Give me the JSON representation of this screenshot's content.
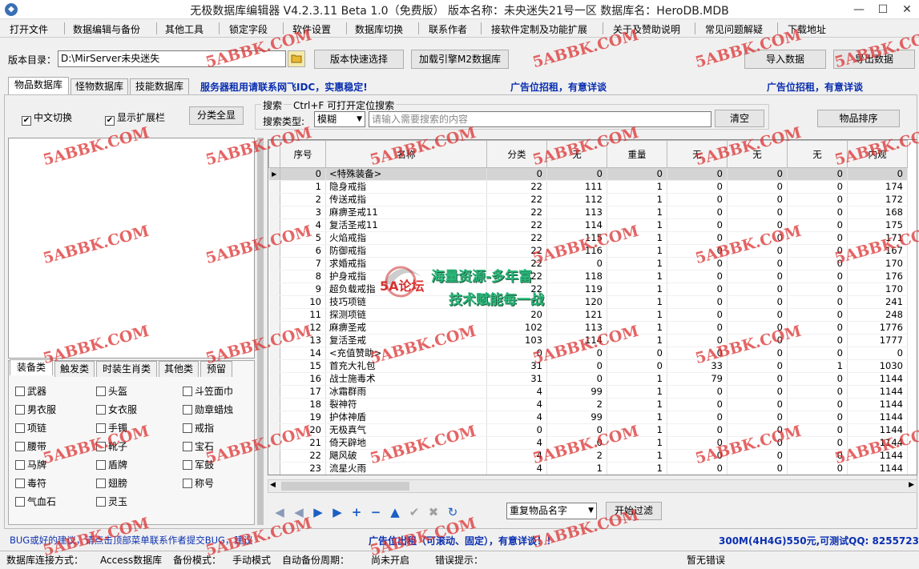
{
  "window": {
    "title": "无极数据库编辑器 V4.2.3.11    Beta 1.0（免费版）    版本名称：未央迷失21号一区    数据库名：HeroDB.MDB",
    "minimize": "—",
    "maximize": "☐",
    "close": "✕"
  },
  "menu": [
    "打开文件",
    "数据编辑与备份",
    "其他工具",
    "锁定字段",
    "软件设置",
    "数据库切换",
    "联系作者",
    "接软件定制及功能扩展",
    "关于及赞助说明",
    "常见问题解疑",
    "下载地址"
  ],
  "toolbar": {
    "dir_label": "版本目录：",
    "dir_value": "D:\\MirServer未央迷失",
    "folder_icon": "folder-icon",
    "quick_select": "版本快速选择",
    "load_engine": "加载引擎M2数据库",
    "import": "导入数据",
    "export": "导出数据"
  },
  "tabs": [
    "物品数据库",
    "怪物数据库",
    "技能数据库"
  ],
  "ads": {
    "ad1": "服务器租用请联系网飞IDC，实惠稳定!",
    "ad2": "广告位招租，有意详谈",
    "ad3": "广告位招租，有意详谈",
    "bottom": "广告位出租（可滚动、固定），有意详谈！！"
  },
  "options": {
    "chinese_switch": "中文切换",
    "show_expand": "显示扩展栏",
    "expand_all": "分类全显"
  },
  "search": {
    "title": "搜索",
    "hint": "Ctrl+F 可打开定位搜索",
    "type_label": "搜索类型:",
    "type_value": "模糊",
    "placeholder": "请输入需要搜索的内容",
    "clear": "清空",
    "sort": "物品排序"
  },
  "category_tabs": [
    "装备类",
    "触发类",
    "时装生肖类",
    "其他类",
    "预留"
  ],
  "categories": [
    "武器",
    "头盔",
    "斗笠面巾",
    "男衣服",
    "女衣服",
    "勋章蜡烛",
    "项链",
    "手镯",
    "戒指",
    "腰带",
    "靴子",
    "宝石",
    "马牌",
    "盾牌",
    "军鼓",
    "毒符",
    "翅膀",
    "称号",
    "气血石",
    "灵玉"
  ],
  "grid": {
    "columns": [
      "序号",
      "名称",
      "分类",
      "无",
      "重量",
      "无",
      "无",
      "无",
      "内观"
    ],
    "rows": [
      [
        "0",
        "<特殊装备>",
        "0",
        "0",
        "0",
        "0",
        "0",
        "0",
        "0"
      ],
      [
        "1",
        "隐身戒指",
        "22",
        "111",
        "1",
        "0",
        "0",
        "0",
        "174"
      ],
      [
        "2",
        "传送戒指",
        "22",
        "112",
        "1",
        "0",
        "0",
        "0",
        "172"
      ],
      [
        "3",
        "麻痹圣戒11",
        "22",
        "113",
        "1",
        "0",
        "0",
        "0",
        "168"
      ],
      [
        "4",
        "复活圣戒11",
        "22",
        "114",
        "1",
        "0",
        "0",
        "0",
        "175"
      ],
      [
        "5",
        "火焰戒指",
        "22",
        "115",
        "1",
        "0",
        "0",
        "0",
        "171"
      ],
      [
        "6",
        "防御戒指",
        "22",
        "116",
        "1",
        "0",
        "0",
        "0",
        "167"
      ],
      [
        "7",
        "求婚戒指",
        "22",
        "0",
        "1",
        "0",
        "0",
        "0",
        "170"
      ],
      [
        "8",
        "护身戒指",
        "22",
        "118",
        "1",
        "0",
        "0",
        "0",
        "176"
      ],
      [
        "9",
        "超负载戒指",
        "22",
        "119",
        "1",
        "0",
        "0",
        "0",
        "170"
      ],
      [
        "10",
        "技巧项链",
        "20",
        "120",
        "1",
        "0",
        "0",
        "0",
        "241"
      ],
      [
        "11",
        "探测项链",
        "20",
        "121",
        "1",
        "0",
        "0",
        "0",
        "248"
      ],
      [
        "12",
        "麻痹圣戒",
        "102",
        "113",
        "1",
        "0",
        "0",
        "0",
        "1776"
      ],
      [
        "13",
        "复活圣戒",
        "103",
        "114",
        "1",
        "0",
        "0",
        "0",
        "1777"
      ],
      [
        "14",
        "<充值赞助>",
        "0",
        "0",
        "0",
        "0",
        "0",
        "0",
        "0"
      ],
      [
        "15",
        "首充大礼包",
        "31",
        "0",
        "0",
        "33",
        "0",
        "1",
        "1030"
      ],
      [
        "16",
        "战士施毒术",
        "31",
        "0",
        "1",
        "79",
        "0",
        "0",
        "1144"
      ],
      [
        "17",
        "冰霜群雨",
        "4",
        "99",
        "1",
        "0",
        "0",
        "0",
        "1144"
      ],
      [
        "18",
        "裂神符",
        "4",
        "2",
        "1",
        "0",
        "0",
        "0",
        "1144"
      ],
      [
        "19",
        "护体神盾",
        "4",
        "99",
        "1",
        "0",
        "0",
        "0",
        "1144"
      ],
      [
        "20",
        "无极真气",
        "0",
        "0",
        "1",
        "0",
        "0",
        "0",
        "1144"
      ],
      [
        "21",
        "倚天辟地",
        "4",
        "0",
        "1",
        "0",
        "0",
        "0",
        "1144"
      ],
      [
        "22",
        "飓风破",
        "4",
        "2",
        "1",
        "0",
        "0",
        "0",
        "1144"
      ],
      [
        "23",
        "流星火雨",
        "4",
        "1",
        "1",
        "0",
        "0",
        "0",
        "1144"
      ]
    ]
  },
  "bottom_bar": {
    "nav_first": "◀",
    "nav_prev": "◀",
    "nav_next": "▶",
    "nav_last": "▶",
    "nav_add": "+",
    "nav_remove": "−",
    "nav_up": "▲",
    "nav_ok": "✔",
    "nav_cancel": "✖",
    "nav_refresh": "↻",
    "filter_value": "重复物品名字",
    "filter_button": "开始过滤"
  },
  "info": {
    "bug_text": "BUG或好的建议，请点击顶部菜单联系作者提交BUG，建议",
    "server_text": "300M(4H4G)550元,可测试QQ: 8255723"
  },
  "statusbar": {
    "conn_label": "数据库连接方式：",
    "conn_value": "Access数据库",
    "backup_label": "备份模式：",
    "backup_value": "手动模式",
    "auto_label": "自动备份周期：",
    "auto_value": "尚未开启",
    "error_label": "错误提示：",
    "error_value": "暂无错误"
  },
  "watermarks": [
    "5ABBK.COM",
    "5ABBK.COM",
    "5ABBK.COM",
    "5ABBK.COM",
    "5ABBK.COM",
    "5ABBK.COM",
    "5ABBK.COM",
    "5ABBK.COM",
    "5ABBK.COM",
    "5ABBK.COM",
    "5ABBK.COM",
    "5ABBK.COM",
    "5ABBK.COM",
    "5ABBK.COM",
    "5ABBK.COM",
    "5ABBK.COM",
    "5ABBK.COM",
    "5ABBK.COM",
    "5ABBK.COM",
    "5ABBK.COM",
    "5ABBK.COM",
    "5ABBK.COM",
    "5ABBK.COM",
    "5ABBK.COM",
    "5ABBK.COM",
    "5ABBK.COM",
    "5ABBK.COM",
    "5ABBK.COM",
    "5ABBK.COM",
    "5ABBK.COM"
  ],
  "center_logo": {
    "brand": "5A论坛",
    "line1": "海量资源-多年富",
    "line2": "技术赋能每一战"
  }
}
